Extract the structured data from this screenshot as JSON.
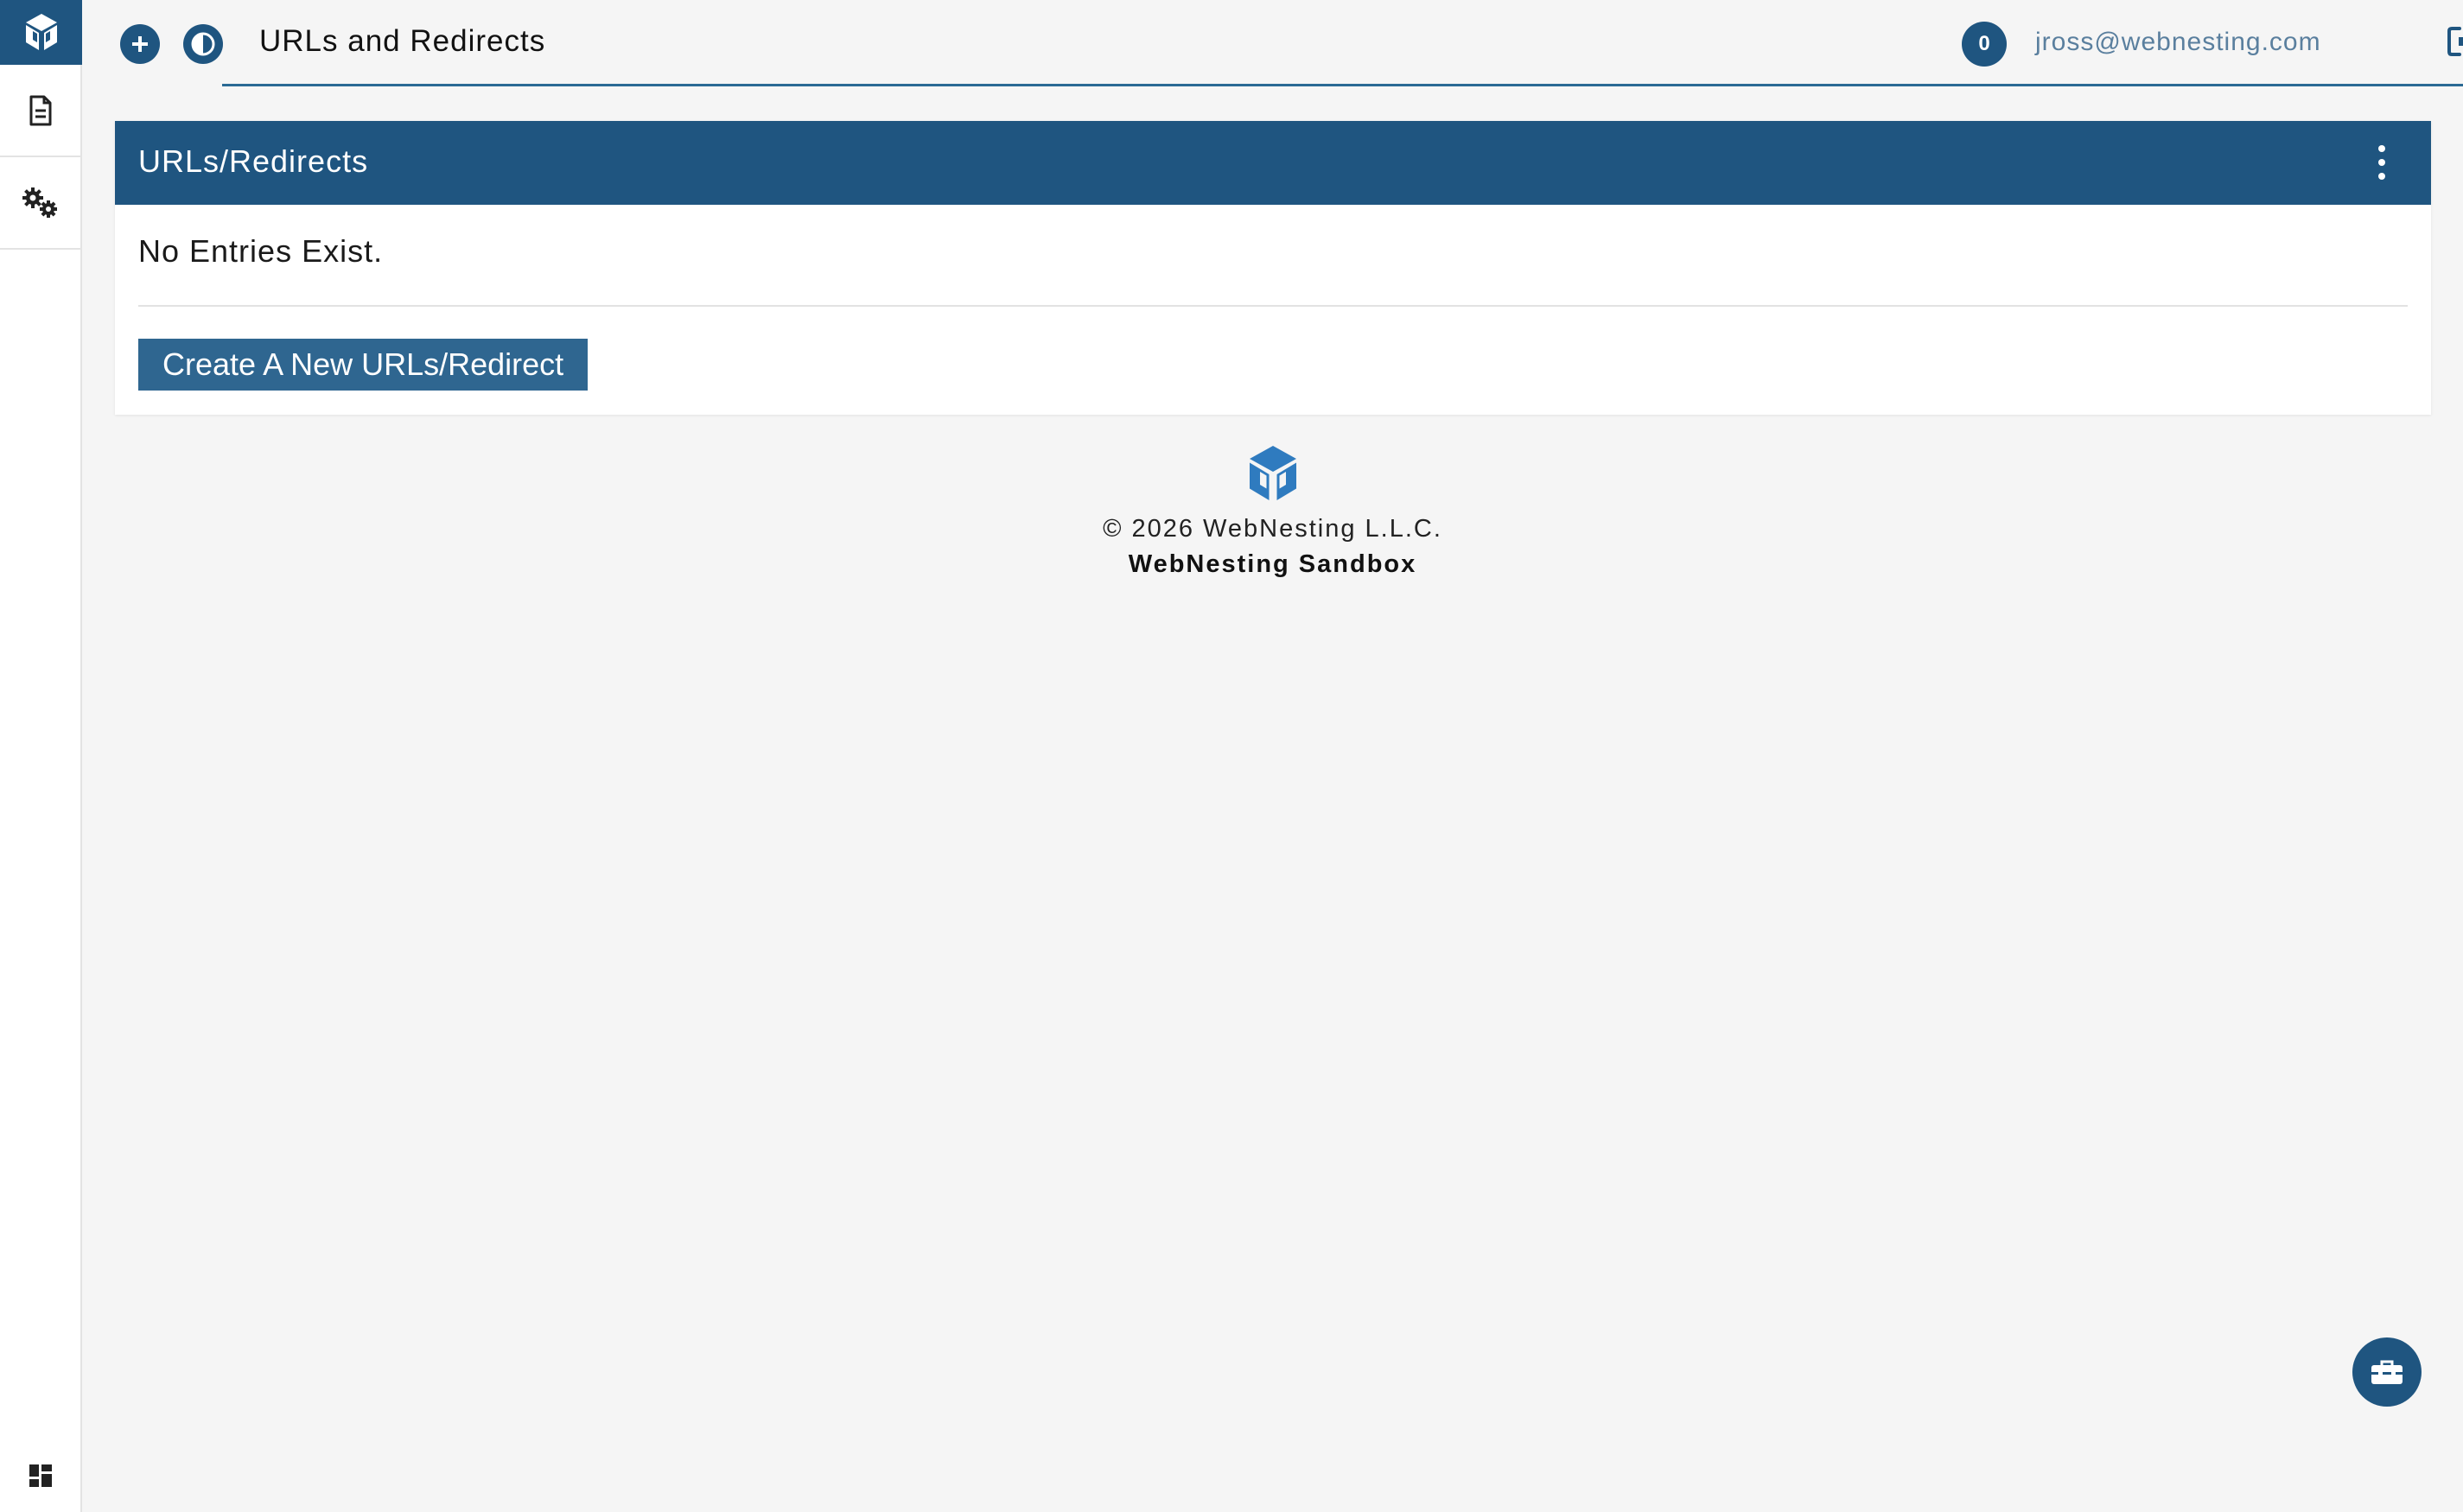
{
  "sidebar": {
    "logo_icon": "webnesting-cube-logo",
    "items": [
      {
        "icon": "document-icon",
        "label": "Pages"
      },
      {
        "icon": "gears-icon",
        "label": "Settings"
      }
    ],
    "bottom_icon": "dashboard-grid-icon"
  },
  "header": {
    "title": "URLs and Redirects",
    "add_icon": "plus-circle-icon",
    "theme_icon": "contrast-icon",
    "notification_count": "0",
    "user_email": "jross@webnesting.com",
    "logout_icon": "sign-out-icon"
  },
  "panel": {
    "title": "URLs/Redirects",
    "menu_icon": "vertical-ellipsis-icon",
    "empty_message": "No Entries Exist.",
    "create_button_label": "Create A New URLs/Redirect"
  },
  "footer": {
    "copyright": "© 2026 WebNesting L.L.C.",
    "site_name": "WebNesting Sandbox"
  },
  "fab": {
    "icon": "toolbox-icon"
  },
  "colors": {
    "primary": "#1f5580",
    "button": "#2f6690",
    "background": "#f5f5f5",
    "logo_blue": "#2f7bbf"
  }
}
